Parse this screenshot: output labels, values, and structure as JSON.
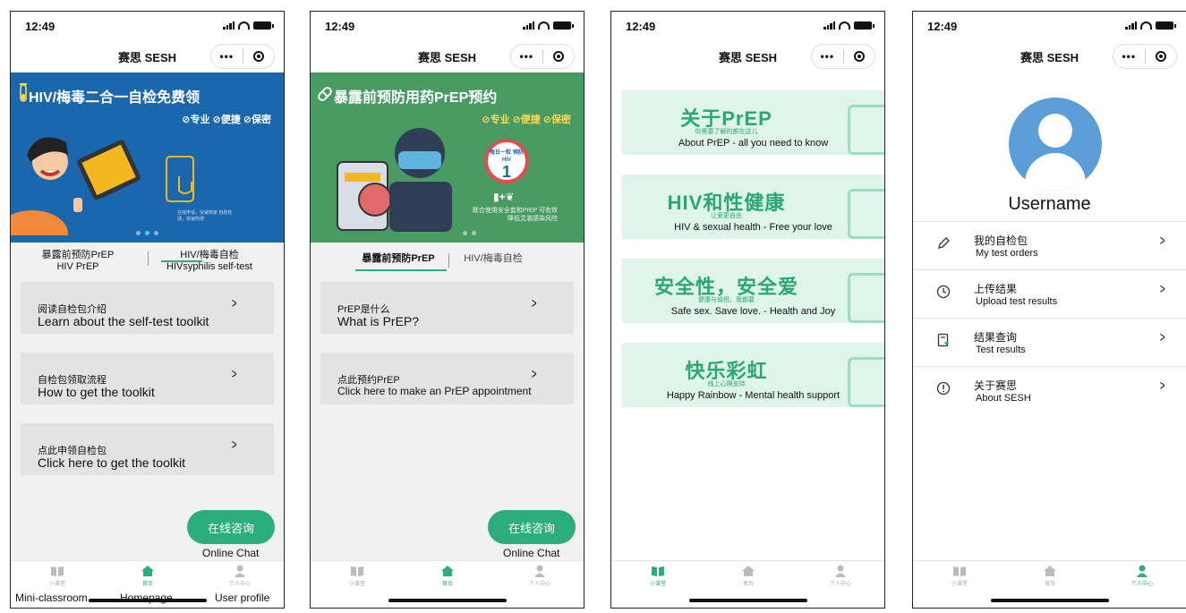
{
  "status_time": "12:49",
  "nav_title": "赛思 SESH",
  "capsule_more": "•••",
  "colors": {
    "brand_green": "#2cae7c",
    "banner_blue": "#1b67ad",
    "banner_green": "#4a9a63"
  },
  "screen1": {
    "banner_title": "HIV/梅毒二合一自检免费领",
    "banner_checks": "⊘专业 ⊘便捷 ⊘保密",
    "banner_small": "在线申请，快速到家 自助检测，快速简便",
    "tab_left_cn": "暴露前预防PrEP",
    "tab_left_en": "HIV PrEP",
    "tab_right_cn": "HIV/梅毒自检",
    "tab_right_en": "HIVsyphilis self-test",
    "cards": [
      {
        "cn": "阅读自检包介绍",
        "en": "Learn about the self-test toolkit"
      },
      {
        "cn": "自检包领取流程",
        "en": "How to get the toolkit"
      },
      {
        "cn": "点此申领自检包",
        "en": "Click here to get the toolkit"
      }
    ],
    "chat_btn": "在线咨询",
    "chat_label": "Online Chat"
  },
  "screen2": {
    "banner_title": "暴露前预防用药PrEP预约",
    "banner_checks": "⊘专业 ⊘便捷 ⊘保密",
    "banner_small": "联合使用安全套和PrEP 可有效降低艾滋感染风险",
    "badge": "每日一粒 预防HIV",
    "tab_left_cn": "暴露前预防PrEP",
    "tab_right_cn": "HIV/梅毒自检",
    "cards": [
      {
        "cn": "PrEP是什么",
        "en": "What is PrEP?"
      },
      {
        "cn": "点此预约PrEP",
        "en": "Click here to make an PrEP appointment"
      }
    ],
    "chat_btn": "在线咨询",
    "chat_label": "Online Chat"
  },
  "screen3": {
    "cards": [
      {
        "title": "关于PrEP",
        "sub": "你需要了解的都在这儿",
        "desc": "About PrEP - all you need to know"
      },
      {
        "title": "HIV和性健康",
        "sub": "让爱更自由",
        "desc": "HIV & sexual health - Free your love"
      },
      {
        "title": "安全性，安全爱",
        "sub": "健康与愉悦，我都要",
        "desc": "Safe sex. Save love. - Health and Joy"
      },
      {
        "title": "快乐彩虹",
        "sub": "线上心理支持",
        "desc": "Happy Rainbow - Mental health support"
      }
    ]
  },
  "screen4": {
    "username": "Username",
    "menu": [
      {
        "cn": "我的自检包",
        "en": "My test orders",
        "icon": "pen-icon"
      },
      {
        "cn": "上传结果",
        "en": "Upload test results",
        "icon": "clock-icon"
      },
      {
        "cn": "结果查询",
        "en": "Test results",
        "icon": "document-heart-icon"
      },
      {
        "cn": "关于赛思",
        "en": "About SESH",
        "icon": "info-icon"
      }
    ]
  },
  "tabbar": {
    "items": [
      {
        "label": "小课堂",
        "icon": "book-icon"
      },
      {
        "label": "首页",
        "icon": "home-icon"
      },
      {
        "label": "个人中心",
        "icon": "user-icon"
      }
    ],
    "en_labels": [
      "Mini-classroom",
      "Homepage",
      "User profile"
    ]
  }
}
